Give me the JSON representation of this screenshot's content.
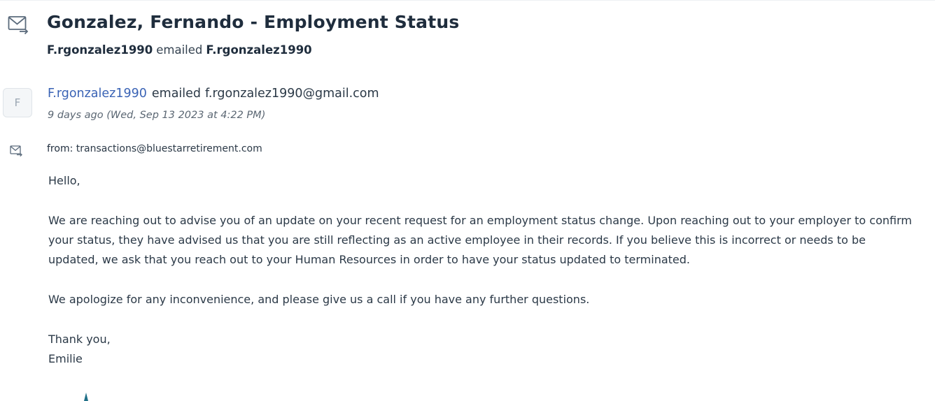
{
  "header": {
    "icon": "mail-forward-icon",
    "title": "Gonzalez, Fernando - Employment Status",
    "sender": "F.rgonzalez1990",
    "verb": "emailed",
    "recipient": "F.rgonzalez1990"
  },
  "message": {
    "avatar_letter": "F",
    "sender": "F.rgonzalez1990",
    "verb": "emailed",
    "recipient_email": "f.rgonzalez1990@gmail.com",
    "timestamp": "9 days ago (Wed, Sep 13 2023 at 4:22 PM)",
    "from_label": "from:",
    "from_value": "transactions@bluestarretirement.com",
    "body": {
      "greeting": "Hello,",
      "paragraph_1": "We are reaching out to advise you of an update on your recent request for an employment status change. Upon reaching out to your employer to confirm your status, they have advised us that you are still reflecting as an active employee in their records. If you believe this is incorrect or needs to be updated, we ask that you reach out to your Human Resources in order to have your status updated to terminated.",
      "paragraph_2": "We apologize for any inconvenience, and please give us a call if you have any further questions.",
      "closing": "Thank you,",
      "signature": "Emilie"
    }
  },
  "colors": {
    "title": "#1f2d3d",
    "sender_link": "#3a63b5",
    "icon_stroke": "#5b6b7c",
    "logo": "#1f6f87"
  }
}
